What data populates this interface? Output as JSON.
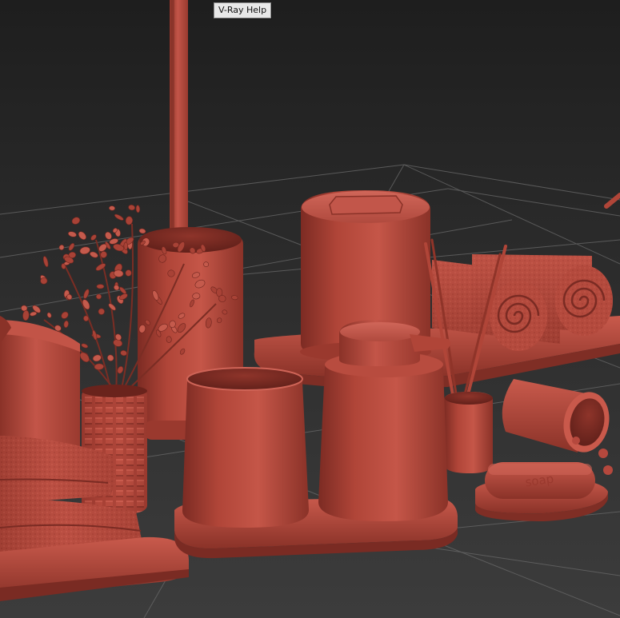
{
  "viewport": {
    "tooltip_text": "V-Ray Help",
    "render_mode": "clay",
    "colors": {
      "background_top": "#1f1f1f",
      "background_bottom": "#3b3b3b",
      "grid_line": "#5e5e5e",
      "clay_base": "#b5483d",
      "clay_shadow": "#7a2a22",
      "clay_highlight": "#cf6457"
    }
  },
  "scene": {
    "objects": [
      {
        "name": "toilet-brush-handle"
      },
      {
        "name": "toilet-brush-holder"
      },
      {
        "name": "potted-plant"
      },
      {
        "name": "textured-vase"
      },
      {
        "name": "lidded-canister"
      },
      {
        "name": "rolled-towels"
      },
      {
        "name": "towel-tray"
      },
      {
        "name": "folded-towels"
      },
      {
        "name": "tumbler-cup"
      },
      {
        "name": "soap-dispenser"
      },
      {
        "name": "bathroom-tray"
      },
      {
        "name": "brush-cup"
      },
      {
        "name": "tipped-cup"
      },
      {
        "name": "bath-beads"
      },
      {
        "name": "soap-bar"
      },
      {
        "name": "soap-dish"
      }
    ]
  }
}
